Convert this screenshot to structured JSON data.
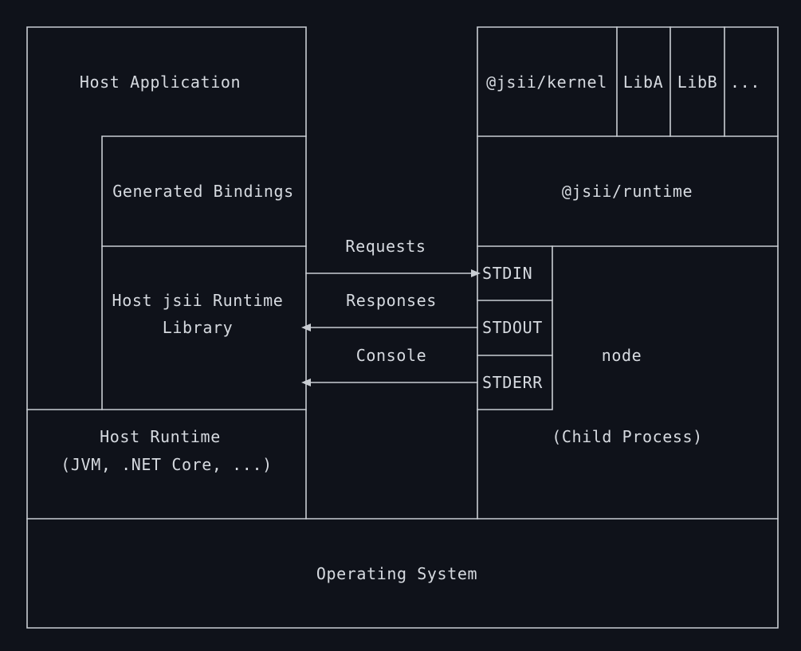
{
  "colors": {
    "background": "#0f121a",
    "line": "#c9cdd3",
    "text": "#d6dae0"
  },
  "host": {
    "application": "Host Application",
    "generated_bindings": "Generated Bindings",
    "runtime_library_line1": "Host jsii Runtime",
    "runtime_library_line2": "Library",
    "runtime_line1": "Host Runtime",
    "runtime_line2": "(JVM, .NET Core, ...)"
  },
  "child": {
    "kernel": "@jsii/kernel",
    "liba": "LibA",
    "libb": "LibB",
    "more": "...",
    "runtime": "@jsii/runtime",
    "node": "node",
    "child_process": "(Child Process)"
  },
  "streams": {
    "stdin": "STDIN",
    "stdout": "STDOUT",
    "stderr": "STDERR"
  },
  "channels": {
    "requests": "Requests",
    "responses": "Responses",
    "console": "Console"
  },
  "os": {
    "label": "Operating System"
  }
}
